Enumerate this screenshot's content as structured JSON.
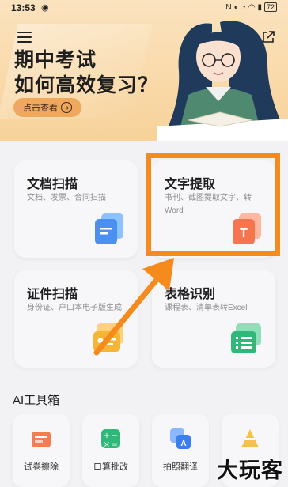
{
  "status_bar": {
    "time": "13:53",
    "battery": "72"
  },
  "banner": {
    "line1": "期中考试",
    "line2": "如何高效复习？",
    "cta_label": "点击查看"
  },
  "cards": [
    {
      "title": "文档扫描",
      "subtitle": "文档、发票、合同扫描"
    },
    {
      "title": "文字提取",
      "subtitle": "书刊、截图提取文字、转Word"
    },
    {
      "title": "证件扫描",
      "subtitle": "身份证、户口本电子版生成"
    },
    {
      "title": "表格识别",
      "subtitle": "课程表、清单表转Excel"
    }
  ],
  "section_title": "AI工具箱",
  "tools": [
    {
      "label": "试卷擦除"
    },
    {
      "label": "口算批改"
    },
    {
      "label": "拍照翻译"
    },
    {
      "label": ""
    }
  ],
  "watermark": "大玩客",
  "colors": {
    "highlight": "#f58a1d",
    "cta": "#f0a85c",
    "banner_bg": "#f9d9a8"
  }
}
